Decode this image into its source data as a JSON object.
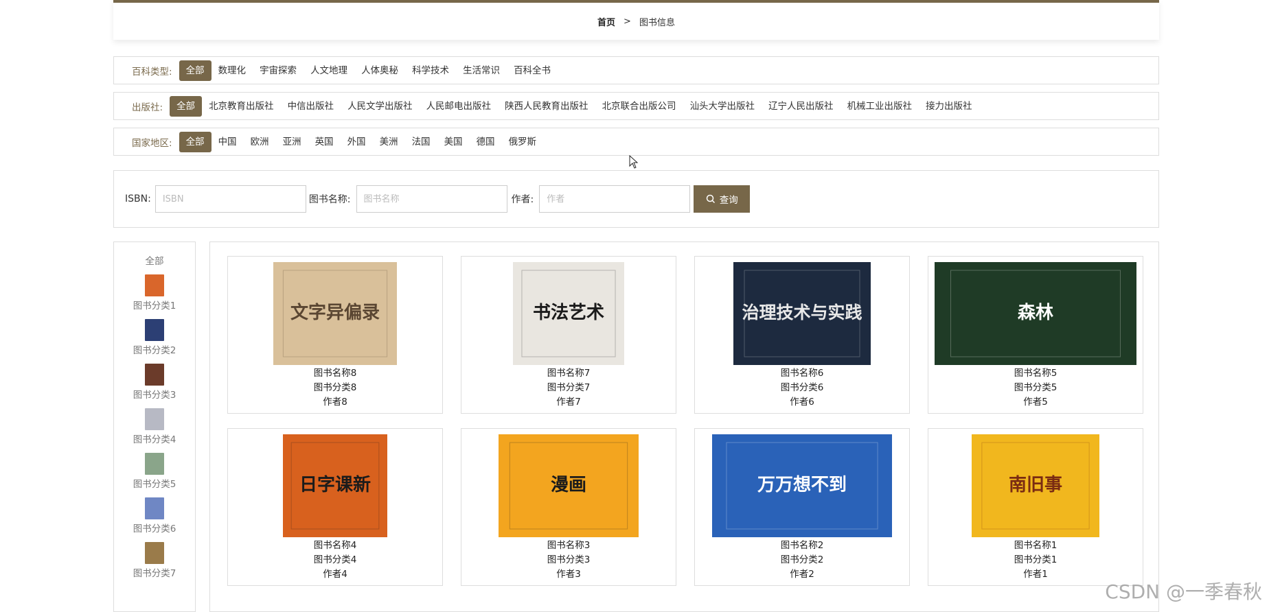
{
  "breadcrumb": {
    "home": "首页",
    "separator": ">",
    "current": "图书信息"
  },
  "filters": [
    {
      "label": "百科类型:",
      "options": [
        "全部",
        "数理化",
        "宇宙探索",
        "人文地理",
        "人体奥秘",
        "科学技术",
        "生活常识",
        "百科全书"
      ],
      "active": 0
    },
    {
      "label": "出版社:",
      "options": [
        "全部",
        "北京教育出版社",
        "中信出版社",
        "人民文学出版社",
        "人民邮电出版社",
        "陕西人民教育出版社",
        "北京联合出版公司",
        "汕头大学出版社",
        "辽宁人民出版社",
        "机械工业出版社",
        "接力出版社"
      ],
      "active": 0
    },
    {
      "label": "国家地区:",
      "options": [
        "全部",
        "中国",
        "欧洲",
        "亚洲",
        "英国",
        "外国",
        "美洲",
        "法国",
        "美国",
        "德国",
        "俄罗斯"
      ],
      "active": 0
    }
  ],
  "search": {
    "isbn_label": "ISBN:",
    "isbn_placeholder": "ISBN",
    "name_label": "图书名称:",
    "name_placeholder": "图书名称",
    "author_label": "作者:",
    "author_placeholder": "作者",
    "button": "查询"
  },
  "categories": {
    "all": "全部",
    "items": [
      {
        "name": "图书分类1",
        "color": "#d9662b"
      },
      {
        "name": "图书分类2",
        "color": "#2c3f74"
      },
      {
        "name": "图书分类3",
        "color": "#6b3b2a"
      },
      {
        "name": "图书分类4",
        "color": "#b7b9c4"
      },
      {
        "name": "图书分类5",
        "color": "#8aa58a"
      },
      {
        "name": "图书分类6",
        "color": "#6f87c4"
      },
      {
        "name": "图书分类7",
        "color": "#9a7b4a"
      }
    ]
  },
  "books": [
    {
      "title": "图书名称8",
      "category": "图书分类8",
      "author": "作者8",
      "cover_text": "文字异偏录",
      "cover_bg": "#d9c09a",
      "cover_fg": "#5a4632"
    },
    {
      "title": "图书名称7",
      "category": "图书分类7",
      "author": "作者7",
      "cover_text": "书法艺术",
      "cover_bg": "#e9e6e0",
      "cover_fg": "#1b1b1b"
    },
    {
      "title": "图书名称6",
      "category": "图书分类6",
      "author": "作者6",
      "cover_text": "治理技术与实践",
      "cover_bg": "#1d2a3f",
      "cover_fg": "#e8e8e8"
    },
    {
      "title": "图书名称5",
      "category": "图书分类5",
      "author": "作者5",
      "cover_text": "森林",
      "cover_bg": "#1f3b26",
      "cover_fg": "#ffffff"
    },
    {
      "title": "图书名称4",
      "category": "图书分类4",
      "author": "作者4",
      "cover_text": "日字课新",
      "cover_bg": "#d8611e",
      "cover_fg": "#1b1b1b"
    },
    {
      "title": "图书名称3",
      "category": "图书分类3",
      "author": "作者3",
      "cover_text": "漫画",
      "cover_bg": "#f3a51f",
      "cover_fg": "#1b1b1b"
    },
    {
      "title": "图书名称2",
      "category": "图书分类2",
      "author": "作者2",
      "cover_text": "万万想不到",
      "cover_bg": "#2a62b8",
      "cover_fg": "#ffffff"
    },
    {
      "title": "图书名称1",
      "category": "图书分类1",
      "author": "作者1",
      "cover_text": "南旧事",
      "cover_bg": "#f1b71e",
      "cover_fg": "#7a2b12"
    }
  ],
  "watermark": "CSDN @一季春秋",
  "accent": "#776749"
}
